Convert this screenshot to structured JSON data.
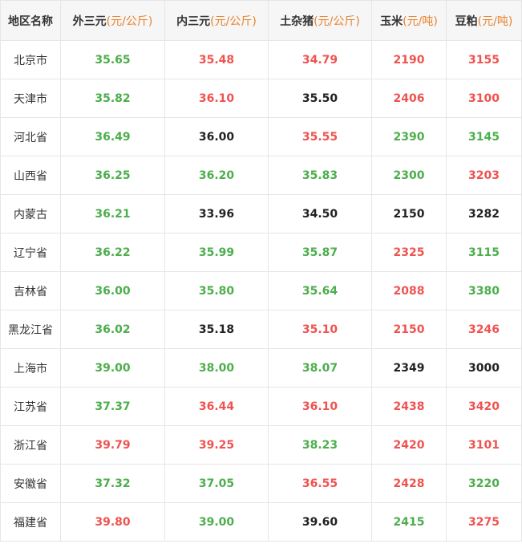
{
  "header": {
    "region": "地区名称",
    "columns": [
      {
        "name": "外三元",
        "unit": "(元/公斤)"
      },
      {
        "name": "内三元",
        "unit": "(元/公斤)"
      },
      {
        "name": "土杂猪",
        "unit": "(元/公斤)"
      },
      {
        "name": "玉米",
        "unit": "(元/吨)"
      },
      {
        "name": "豆粕",
        "unit": "(元/吨)"
      }
    ]
  },
  "colors": {
    "up_green": "#4cae4c",
    "down_red": "#ef5350",
    "flat_black": "#222222",
    "unit_orange": "#e8822b"
  },
  "rows": [
    {
      "region": "北京市",
      "cells": [
        {
          "v": "35.65",
          "c": "green"
        },
        {
          "v": "35.48",
          "c": "red"
        },
        {
          "v": "34.79",
          "c": "red"
        },
        {
          "v": "2190",
          "c": "red"
        },
        {
          "v": "3155",
          "c": "red"
        }
      ]
    },
    {
      "region": "天津市",
      "cells": [
        {
          "v": "35.82",
          "c": "green"
        },
        {
          "v": "36.10",
          "c": "red"
        },
        {
          "v": "35.50",
          "c": "black"
        },
        {
          "v": "2406",
          "c": "red"
        },
        {
          "v": "3100",
          "c": "red"
        }
      ]
    },
    {
      "region": "河北省",
      "cells": [
        {
          "v": "36.49",
          "c": "green"
        },
        {
          "v": "36.00",
          "c": "black"
        },
        {
          "v": "35.55",
          "c": "red"
        },
        {
          "v": "2390",
          "c": "green"
        },
        {
          "v": "3145",
          "c": "green"
        }
      ]
    },
    {
      "region": "山西省",
      "cells": [
        {
          "v": "36.25",
          "c": "green"
        },
        {
          "v": "36.20",
          "c": "green"
        },
        {
          "v": "35.83",
          "c": "green"
        },
        {
          "v": "2300",
          "c": "green"
        },
        {
          "v": "3203",
          "c": "red"
        }
      ]
    },
    {
      "region": "内蒙古",
      "cells": [
        {
          "v": "36.21",
          "c": "green"
        },
        {
          "v": "33.96",
          "c": "black"
        },
        {
          "v": "34.50",
          "c": "black"
        },
        {
          "v": "2150",
          "c": "black"
        },
        {
          "v": "3282",
          "c": "black"
        }
      ]
    },
    {
      "region": "辽宁省",
      "cells": [
        {
          "v": "36.22",
          "c": "green"
        },
        {
          "v": "35.99",
          "c": "green"
        },
        {
          "v": "35.87",
          "c": "green"
        },
        {
          "v": "2325",
          "c": "red"
        },
        {
          "v": "3115",
          "c": "green"
        }
      ]
    },
    {
      "region": "吉林省",
      "cells": [
        {
          "v": "36.00",
          "c": "green"
        },
        {
          "v": "35.80",
          "c": "green"
        },
        {
          "v": "35.64",
          "c": "green"
        },
        {
          "v": "2088",
          "c": "red"
        },
        {
          "v": "3380",
          "c": "green"
        }
      ]
    },
    {
      "region": "黑龙江省",
      "cells": [
        {
          "v": "36.02",
          "c": "green"
        },
        {
          "v": "35.18",
          "c": "black"
        },
        {
          "v": "35.10",
          "c": "red"
        },
        {
          "v": "2150",
          "c": "red"
        },
        {
          "v": "3246",
          "c": "red"
        }
      ]
    },
    {
      "region": "上海市",
      "cells": [
        {
          "v": "39.00",
          "c": "green"
        },
        {
          "v": "38.00",
          "c": "green"
        },
        {
          "v": "38.07",
          "c": "green"
        },
        {
          "v": "2349",
          "c": "black"
        },
        {
          "v": "3000",
          "c": "black"
        }
      ]
    },
    {
      "region": "江苏省",
      "cells": [
        {
          "v": "37.37",
          "c": "green"
        },
        {
          "v": "36.44",
          "c": "red"
        },
        {
          "v": "36.10",
          "c": "red"
        },
        {
          "v": "2438",
          "c": "red"
        },
        {
          "v": "3420",
          "c": "red"
        }
      ]
    },
    {
      "region": "浙江省",
      "cells": [
        {
          "v": "39.79",
          "c": "red"
        },
        {
          "v": "39.25",
          "c": "red"
        },
        {
          "v": "38.23",
          "c": "green"
        },
        {
          "v": "2420",
          "c": "red"
        },
        {
          "v": "3101",
          "c": "red"
        }
      ]
    },
    {
      "region": "安徽省",
      "cells": [
        {
          "v": "37.32",
          "c": "green"
        },
        {
          "v": "37.05",
          "c": "green"
        },
        {
          "v": "36.55",
          "c": "red"
        },
        {
          "v": "2428",
          "c": "red"
        },
        {
          "v": "3220",
          "c": "green"
        }
      ]
    },
    {
      "region": "福建省",
      "cells": [
        {
          "v": "39.80",
          "c": "red"
        },
        {
          "v": "39.00",
          "c": "green"
        },
        {
          "v": "39.60",
          "c": "black"
        },
        {
          "v": "2415",
          "c": "green"
        },
        {
          "v": "3275",
          "c": "red"
        }
      ]
    }
  ]
}
